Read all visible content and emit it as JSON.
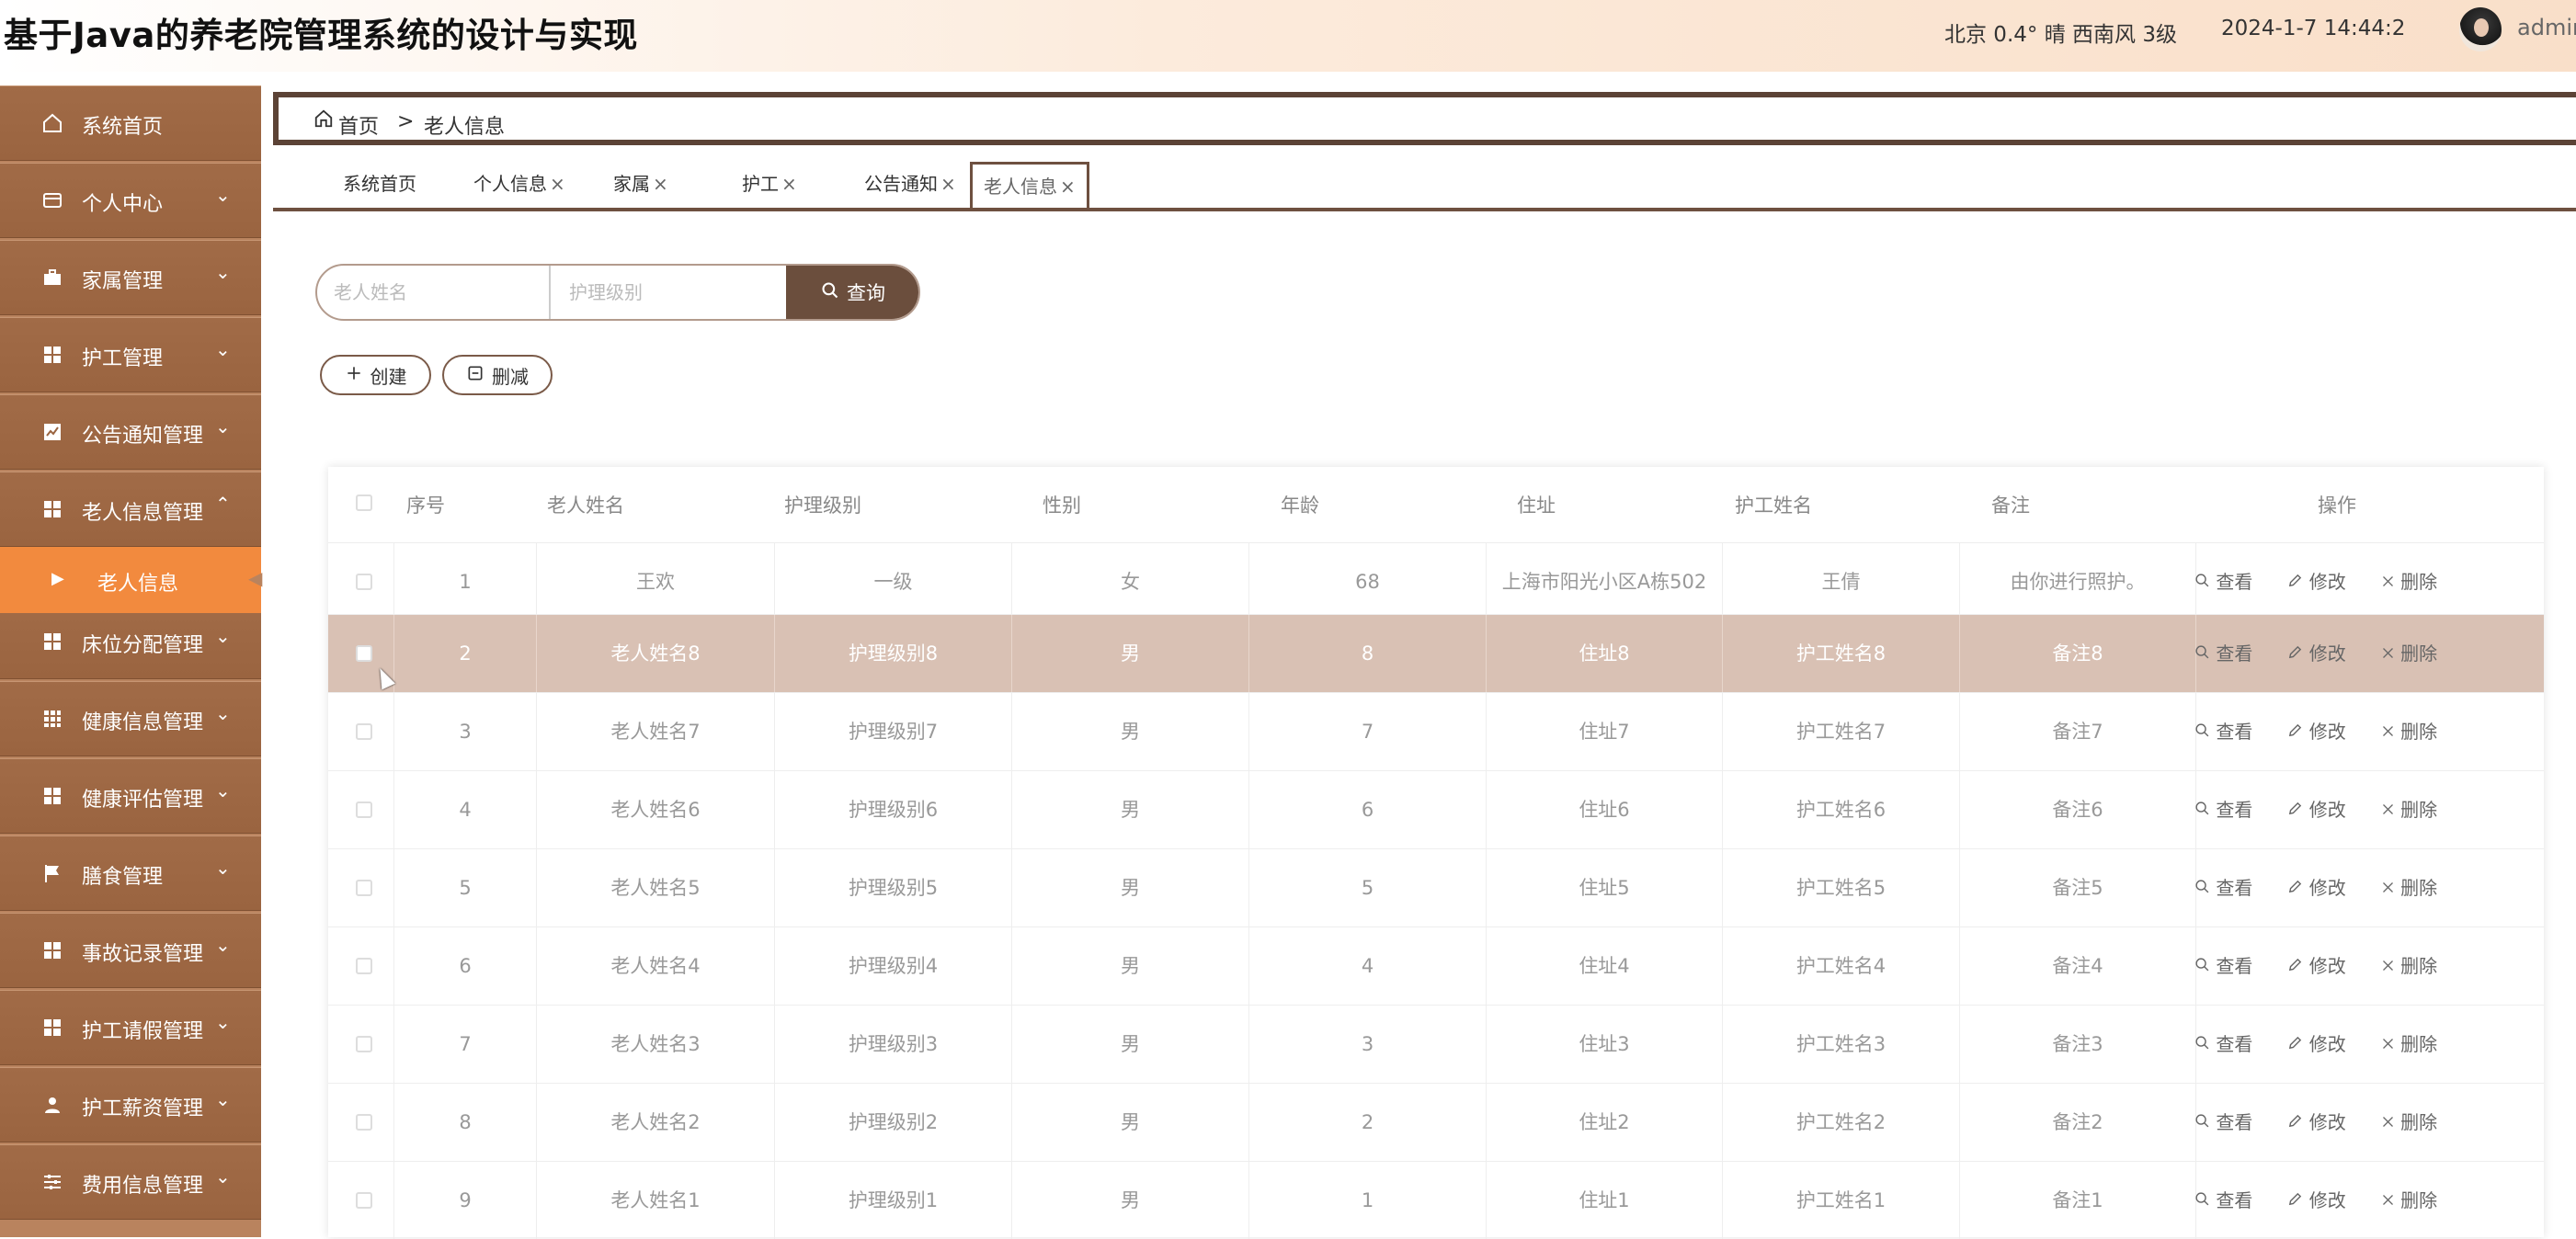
{
  "header": {
    "title": "基于Java的养老院管理系统的设计与实现",
    "weather": "北京  0.4°  晴  西南风  3级",
    "datetime": "2024-1-7 14:44:2",
    "user": "admin"
  },
  "sidebar": {
    "items": [
      {
        "label": "系统首页",
        "icon": "home-icon",
        "chevron": ""
      },
      {
        "label": "个人中心",
        "icon": "card-icon",
        "chevron": "⌄"
      },
      {
        "label": "家属管理",
        "icon": "briefcase-icon",
        "chevron": "⌄"
      },
      {
        "label": "护工管理",
        "icon": "grid-icon",
        "chevron": "⌄"
      },
      {
        "label": "公告通知管理",
        "icon": "chart-icon",
        "chevron": "⌄"
      },
      {
        "label": "老人信息管理",
        "icon": "grid-icon",
        "chevron": "⌃"
      },
      {
        "label": "床位分配管理",
        "icon": "grid-icon",
        "chevron": "⌄"
      },
      {
        "label": "健康信息管理",
        "icon": "table-icon",
        "chevron": "⌄"
      },
      {
        "label": "健康评估管理",
        "icon": "grid-icon",
        "chevron": "⌄"
      },
      {
        "label": "膳食管理",
        "icon": "flag-icon",
        "chevron": "⌄"
      },
      {
        "label": "事故记录管理",
        "icon": "grid-icon",
        "chevron": "⌄"
      },
      {
        "label": "护工请假管理",
        "icon": "grid-icon",
        "chevron": "⌄"
      },
      {
        "label": "护工薪资管理",
        "icon": "person-icon",
        "chevron": "⌄"
      },
      {
        "label": "费用信息管理",
        "icon": "sliders-icon",
        "chevron": "⌄"
      }
    ],
    "active_sub": "老人信息"
  },
  "breadcrumb": {
    "home": "首页",
    "separator": ">",
    "current": "老人信息"
  },
  "tabs": [
    {
      "label": "系统首页",
      "closable": false
    },
    {
      "label": "个人信息",
      "closable": true
    },
    {
      "label": "家属",
      "closable": true
    },
    {
      "label": "护工",
      "closable": true
    },
    {
      "label": "公告通知",
      "closable": true
    },
    {
      "label": "老人信息",
      "closable": true,
      "active": true
    }
  ],
  "search": {
    "name_placeholder": "老人姓名",
    "level_placeholder": "护理级别",
    "button": "查询"
  },
  "actions": {
    "create": "创建",
    "delete": "删减"
  },
  "table": {
    "columns": [
      "序号",
      "老人姓名",
      "护理级别",
      "性别",
      "年龄",
      "住址",
      "护工姓名",
      "备注",
      "操作"
    ],
    "row_ops": {
      "view": "查看",
      "edit": "修改",
      "delete": "删除"
    },
    "rows": [
      [
        "1",
        "王欢",
        "一级",
        "女",
        "68",
        "上海市阳光小区A栋502",
        "王倩",
        "由你进行照护。"
      ],
      [
        "2",
        "老人姓名8",
        "护理级别8",
        "男",
        "8",
        "住址8",
        "护工姓名8",
        "备注8"
      ],
      [
        "3",
        "老人姓名7",
        "护理级别7",
        "男",
        "7",
        "住址7",
        "护工姓名7",
        "备注7"
      ],
      [
        "4",
        "老人姓名6",
        "护理级别6",
        "男",
        "6",
        "住址6",
        "护工姓名6",
        "备注6"
      ],
      [
        "5",
        "老人姓名5",
        "护理级别5",
        "男",
        "5",
        "住址5",
        "护工姓名5",
        "备注5"
      ],
      [
        "6",
        "老人姓名4",
        "护理级别4",
        "男",
        "4",
        "住址4",
        "护工姓名4",
        "备注4"
      ],
      [
        "7",
        "老人姓名3",
        "护理级别3",
        "男",
        "3",
        "住址3",
        "护工姓名3",
        "备注3"
      ],
      [
        "8",
        "老人姓名2",
        "护理级别2",
        "男",
        "2",
        "住址2",
        "护工姓名2",
        "备注2"
      ],
      [
        "9",
        "老人姓名1",
        "护理级别1",
        "男",
        "1",
        "住址1",
        "护工姓名1",
        "备注1"
      ]
    ],
    "highlighted_row": 2
  },
  "colors": {
    "sidebar": "#9a6440",
    "sidebar_active": "#f28a3e",
    "accent": "#6b4e3d",
    "row_highlight": "#d9c1b4"
  }
}
